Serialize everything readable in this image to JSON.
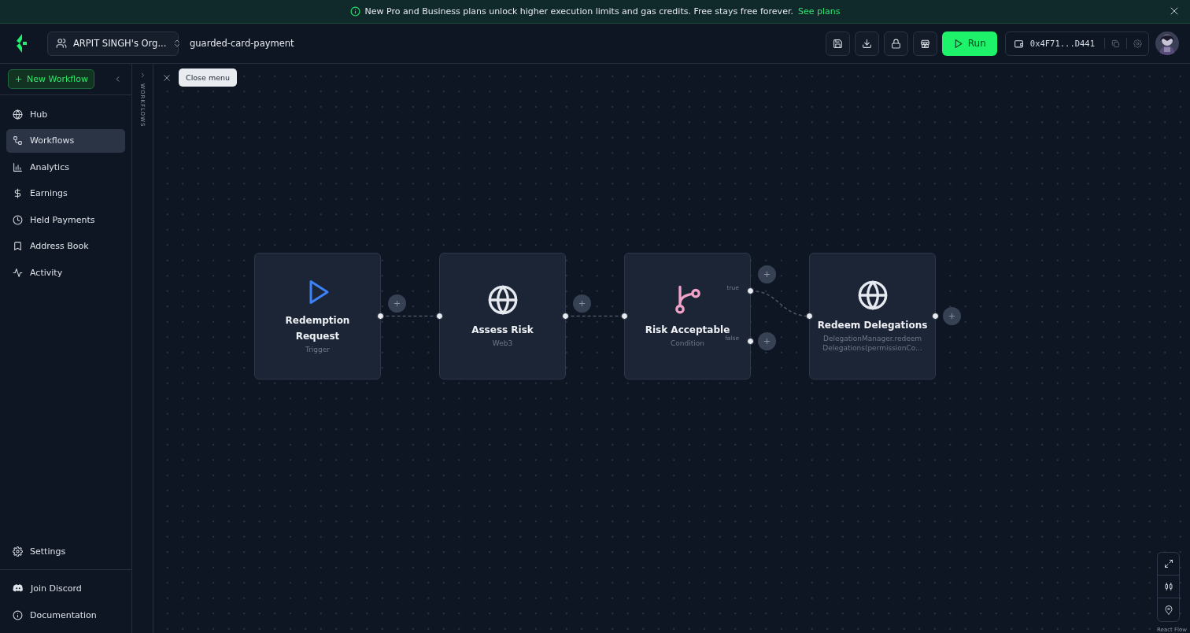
{
  "banner": {
    "message": "New Pro and Business plans unlock higher execution limits and gas credits. Free stays free forever.",
    "link": "See plans"
  },
  "header": {
    "org": "ARPIT SINGH's Org...",
    "workflow_name": "guarded-card-payment",
    "run_label": "Run",
    "wallet": "0x4F71...D441"
  },
  "sidebar": {
    "new_button": "New Workflow",
    "items": [
      {
        "label": "Hub",
        "selected": false
      },
      {
        "label": "Workflows",
        "selected": true
      },
      {
        "label": "Analytics",
        "selected": false
      },
      {
        "label": "Earnings",
        "selected": false
      },
      {
        "label": "Held Payments",
        "selected": false
      },
      {
        "label": "Address Book",
        "selected": false
      },
      {
        "label": "Activity",
        "selected": false
      }
    ],
    "settings": "Settings",
    "links": [
      "Join Discord",
      "Documentation"
    ]
  },
  "panel": {
    "label": "WORKFLOWS",
    "tooltip": "Close menu"
  },
  "nodes": [
    {
      "kind": "trigger",
      "title": "Redemption\nRequest",
      "subtitle": "Trigger"
    },
    {
      "kind": "web3",
      "title": "Assess Risk",
      "subtitle": "Web3"
    },
    {
      "kind": "condition",
      "title": "Risk Acceptable",
      "subtitle": "Condition",
      "branches": [
        "true",
        "false"
      ]
    },
    {
      "kind": "web3",
      "title": "Redeem Delegations",
      "subtitle": "DelegationManager.redeem Delegations(permissionCo..."
    }
  ],
  "attribution": "React Flow"
}
